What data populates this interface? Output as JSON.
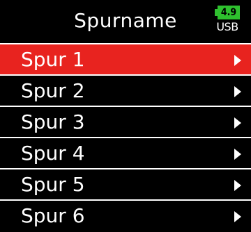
{
  "header": {
    "title": "Spurname"
  },
  "status": {
    "battery_voltage": "4.9",
    "power_source": "USB",
    "battery_color": "#2ec12e"
  },
  "menu": {
    "selected_index": 0,
    "selected_color": "#e8231f",
    "items": [
      {
        "label": "Spur 1"
      },
      {
        "label": "Spur 2"
      },
      {
        "label": "Spur 3"
      },
      {
        "label": "Spur 4"
      },
      {
        "label": "Spur 5"
      },
      {
        "label": "Spur 6"
      }
    ]
  }
}
